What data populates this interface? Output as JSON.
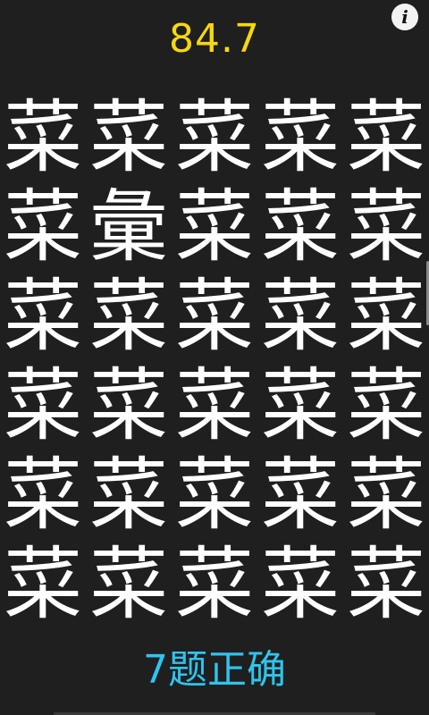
{
  "game": {
    "timer": "84.7",
    "info_label": "i",
    "score_text": "7题正确",
    "colors": {
      "background": "#1f1f1f",
      "timer": "#f5d80f",
      "score": "#2ec4ee",
      "glyph": "#ffffff"
    }
  },
  "grid": {
    "rows": [
      [
        "菜",
        "菜",
        "菜",
        "菜",
        "菜"
      ],
      [
        "菜",
        "彙",
        "菜",
        "菜",
        "菜"
      ],
      [
        "菜",
        "菜",
        "菜",
        "菜",
        "菜"
      ],
      [
        "菜",
        "菜",
        "菜",
        "菜",
        "菜"
      ],
      [
        "菜",
        "菜",
        "菜",
        "菜",
        "菜"
      ],
      [
        "菜",
        "菜",
        "菜",
        "菜",
        "菜"
      ]
    ]
  }
}
